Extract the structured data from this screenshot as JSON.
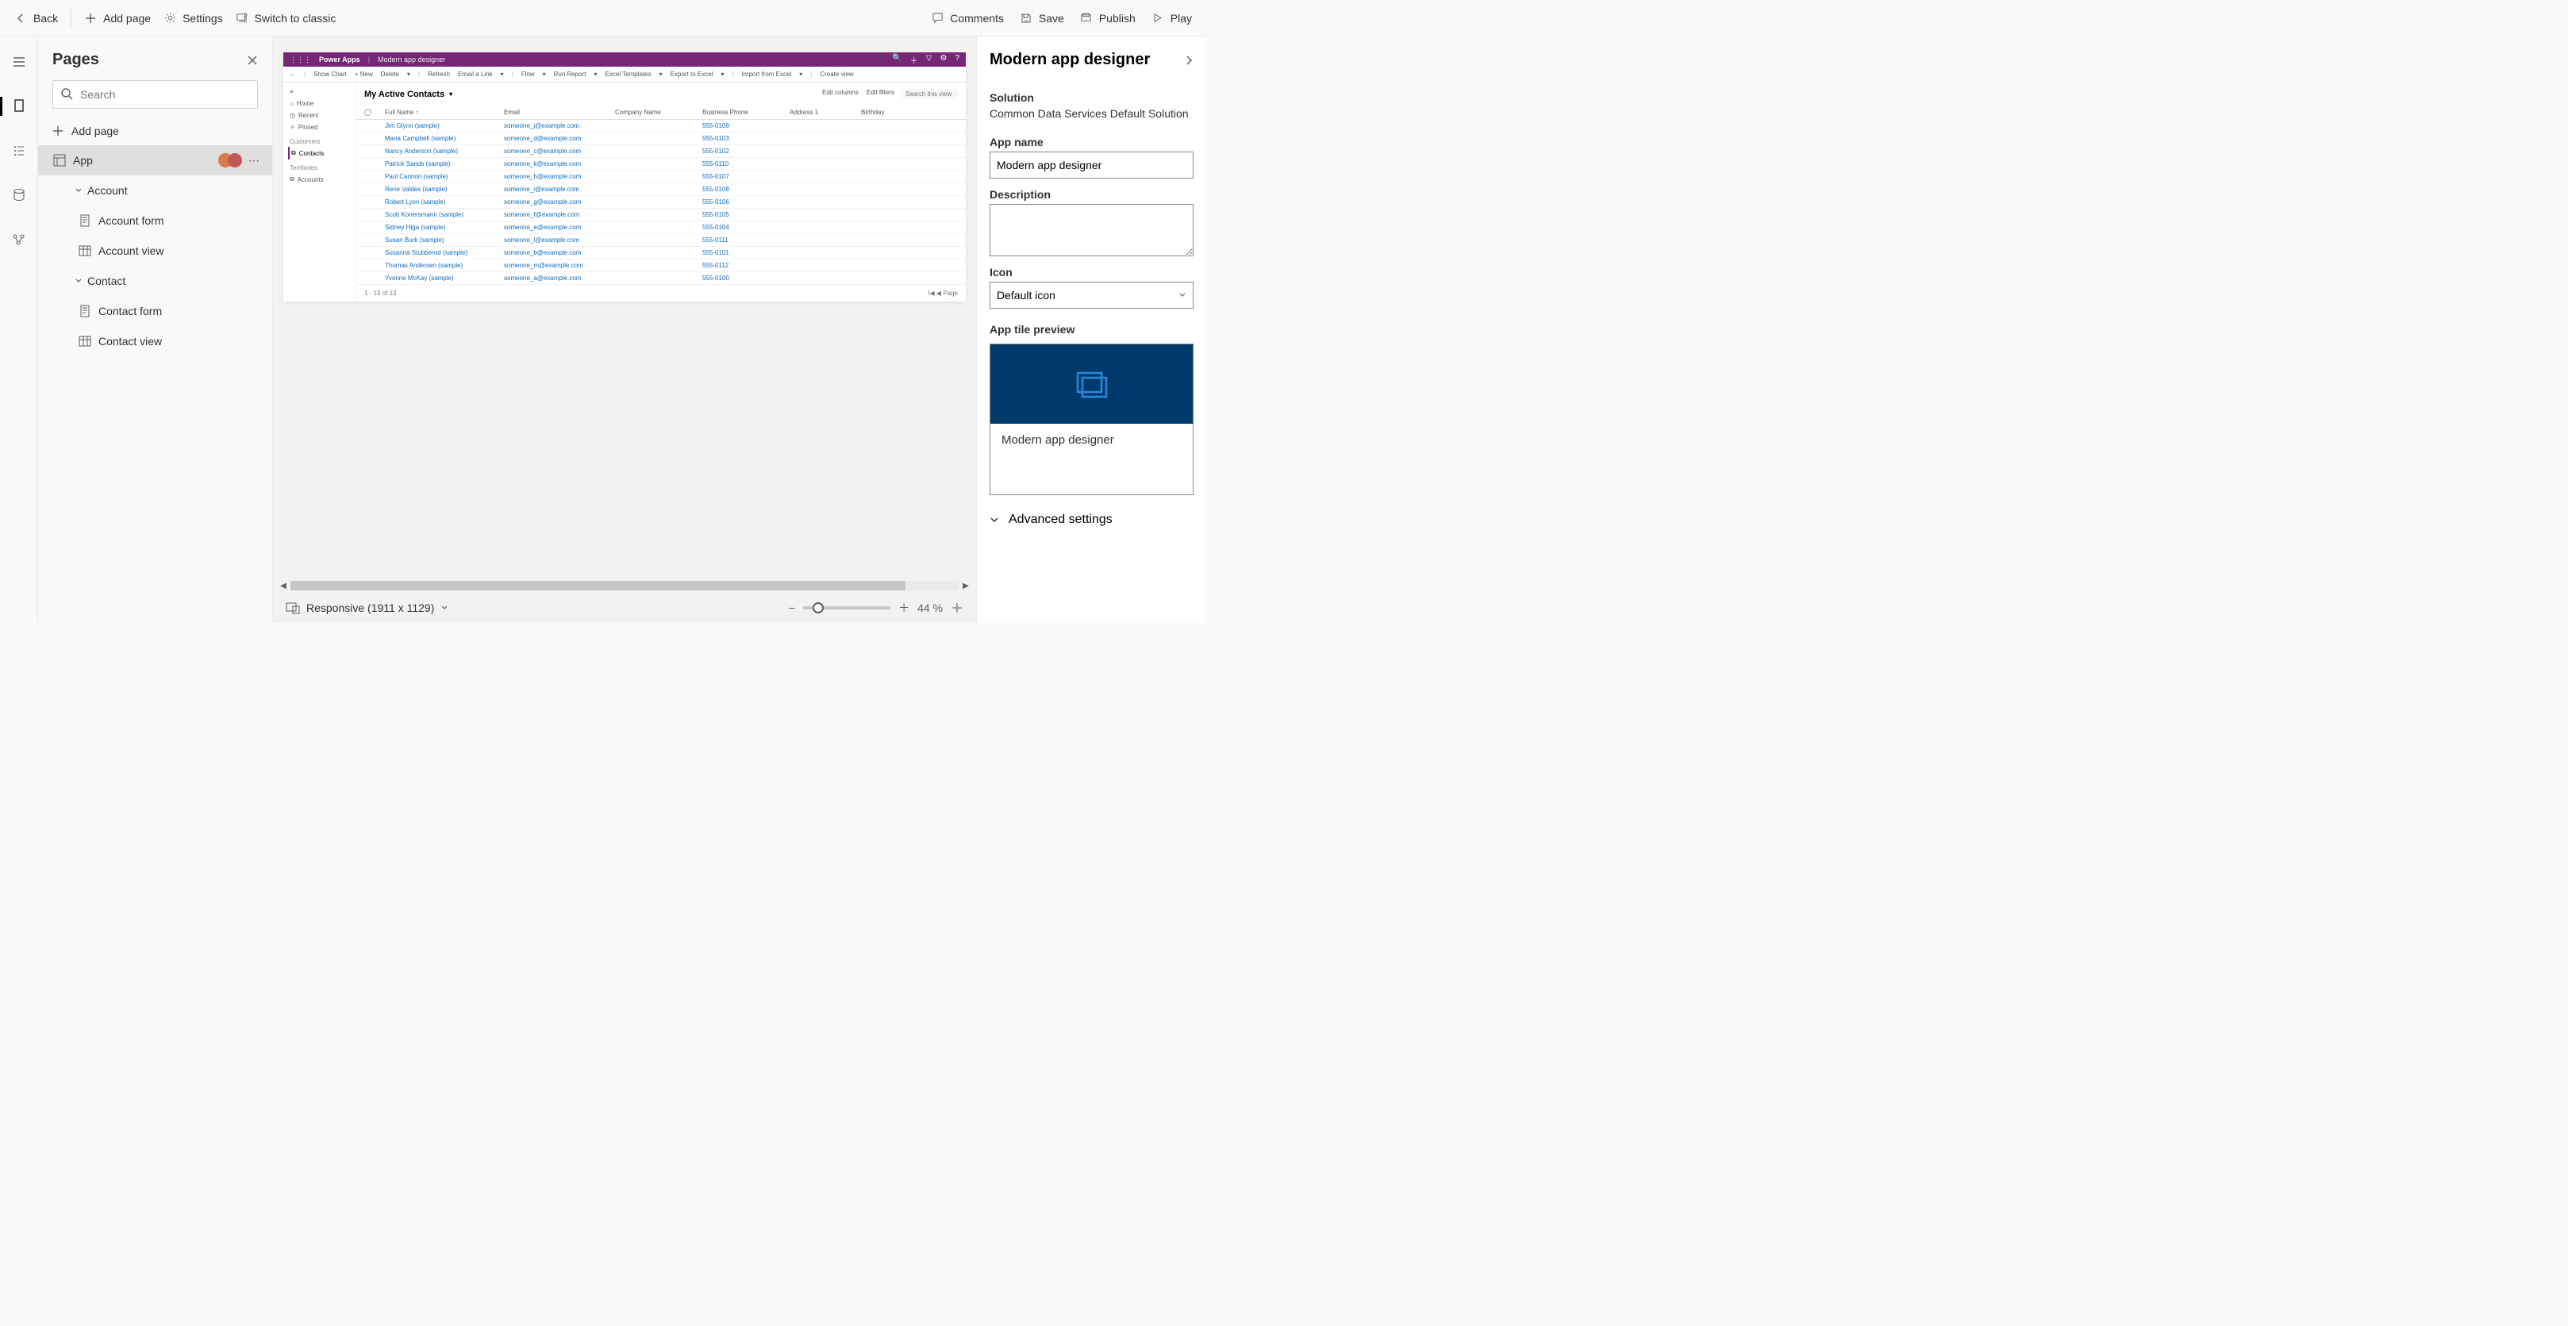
{
  "topbar": {
    "back": "Back",
    "add_page": "Add page",
    "settings": "Settings",
    "switch_classic": "Switch to classic",
    "comments": "Comments",
    "save": "Save",
    "publish": "Publish",
    "play": "Play"
  },
  "pages_pane": {
    "title": "Pages",
    "search_placeholder": "Search",
    "add_page": "Add page",
    "app_label": "App",
    "tree": {
      "account": "Account",
      "account_form": "Account form",
      "account_view": "Account view",
      "contact": "Contact",
      "contact_form": "Contact form",
      "contact_view": "Contact view"
    }
  },
  "preview": {
    "brand": "Power Apps",
    "app_name": "Modern app designer",
    "cmdbar": [
      "Show Chart",
      "+ New",
      "Delete",
      "Refresh",
      "Email a Link",
      "Flow",
      "Run Report",
      "Excel Templates",
      "Export to Excel",
      "Import from Excel",
      "Create view"
    ],
    "nav": {
      "home": "Home",
      "recent": "Recent",
      "pinned": "Pinned",
      "customers_label": "Customers",
      "contacts": "Contacts",
      "territories": "Territories",
      "accounts": "Accounts"
    },
    "view_title": "My Active Contacts",
    "tools": {
      "edit_columns": "Edit columns",
      "edit_filters": "Edit filters",
      "search_placeholder": "Search this view"
    },
    "columns": [
      "Full Name ↑",
      "Email",
      "Company Name",
      "Business Phone",
      "Address 1",
      "Birthday"
    ],
    "rows": [
      {
        "name": "Jim Glynn (sample)",
        "email": "someone_j@example.com",
        "phone": "555-0109"
      },
      {
        "name": "Maria Campbell (sample)",
        "email": "someone_d@example.com",
        "phone": "555-0103"
      },
      {
        "name": "Nancy Anderson (sample)",
        "email": "someone_c@example.com",
        "phone": "555-0102"
      },
      {
        "name": "Patrick Sands (sample)",
        "email": "someone_k@example.com",
        "phone": "555-0110"
      },
      {
        "name": "Paul Cannon (sample)",
        "email": "someone_h@example.com",
        "phone": "555-0107"
      },
      {
        "name": "Rene Valdes (sample)",
        "email": "someone_i@example.com",
        "phone": "555-0108"
      },
      {
        "name": "Robert Lyon (sample)",
        "email": "someone_g@example.com",
        "phone": "555-0106"
      },
      {
        "name": "Scott Konersmann (sample)",
        "email": "someone_f@example.com",
        "phone": "555-0105"
      },
      {
        "name": "Sidney Higa (sample)",
        "email": "someone_e@example.com",
        "phone": "555-0104"
      },
      {
        "name": "Susan Burk (sample)",
        "email": "someone_l@example.com",
        "phone": "555-0111"
      },
      {
        "name": "Susanna Stubberod (sample)",
        "email": "someone_b@example.com",
        "phone": "555-0101"
      },
      {
        "name": "Thomas Andersen (sample)",
        "email": "someone_m@example.com",
        "phone": "555-0112"
      },
      {
        "name": "Yvonne McKay (sample)",
        "email": "someone_a@example.com",
        "phone": "555-0100"
      }
    ],
    "footer_left": "1 - 13 of 13",
    "footer_right": "Page"
  },
  "zoom": {
    "responsive_label": "Responsive (1911 x 1129)",
    "percent": "44 %"
  },
  "props": {
    "title": "Modern app designer",
    "solution_label": "Solution",
    "solution_value": "Common Data Services Default Solution",
    "app_name_label": "App name",
    "app_name_value": "Modern app designer",
    "description_label": "Description",
    "icon_label": "Icon",
    "icon_value": "Default icon",
    "tile_preview_label": "App tile preview",
    "tile_text": "Modern app designer",
    "advanced": "Advanced settings"
  }
}
